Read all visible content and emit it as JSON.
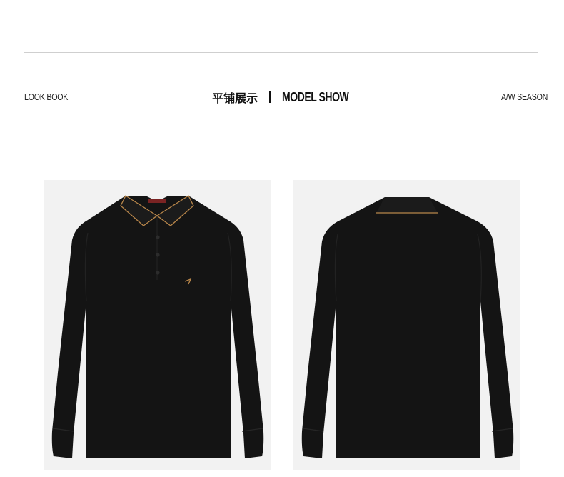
{
  "header": {
    "left_label": "LOOK BOOK",
    "title_cn": "平铺展示",
    "title_en": "MODEL SHOW",
    "right_label": "A/W SEASON"
  },
  "products": [
    {
      "view": "front",
      "garment": "long-sleeve-polo-shirt",
      "color": "#141414",
      "trim_color": "#b8864a"
    },
    {
      "view": "back",
      "garment": "long-sleeve-polo-shirt",
      "color": "#141414",
      "trim_color": "#b8864a"
    }
  ]
}
